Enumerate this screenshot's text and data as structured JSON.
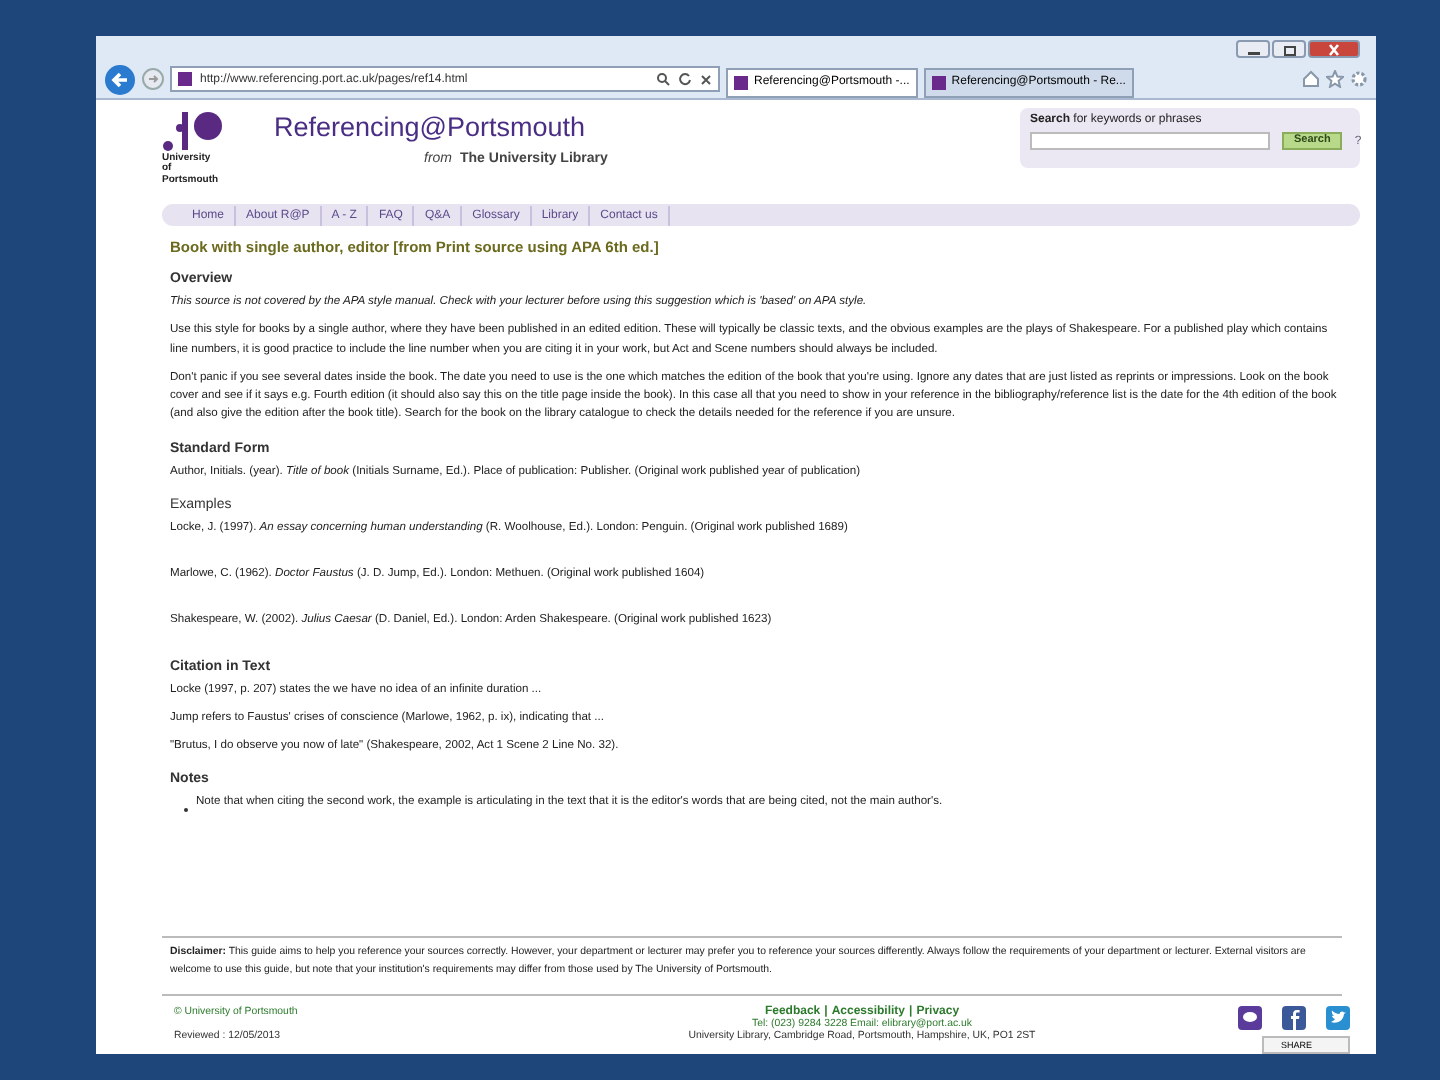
{
  "browser": {
    "url": "http://www.referencing.port.ac.uk/pages/ref14.html",
    "tabs": [
      {
        "label": "Referencing@Portsmouth -...",
        "selected": true
      },
      {
        "label": "Referencing@Portsmouth - Re...",
        "selected": false
      }
    ]
  },
  "header": {
    "logo_text": "University of Portsmouth",
    "title": "Referencing@Portsmouth",
    "from": "from",
    "subtitle": "The University Library",
    "search_label": "**Search** for keywords or phrases",
    "search_button": "Search",
    "search_help": "?"
  },
  "nav": [
    {
      "label": "Home"
    },
    {
      "label": "About R@P"
    },
    {
      "label": "A - Z"
    },
    {
      "label": "FAQ"
    },
    {
      "label": "Q&A"
    },
    {
      "label": "Glossary"
    },
    {
      "label": "Library"
    },
    {
      "label": "Contact us"
    }
  ],
  "page_title": "Book with single author, editor [from Print source using APA 6th ed.]",
  "content": [
    {
      "kind": "heading",
      "text": "Overview"
    },
    {
      "kind": "note",
      "text": "This source is not covered by the APA style manual. Check with your lecturer before using this suggestion which is 'based' on APA style."
    },
    {
      "kind": "para",
      "text": "Use this style for books by a single author, where they have been published in an edited edition. These will typically be classic texts, and the obvious examples are the plays of Shakespeare.  For a published play which contains line numbers, it is good practice to include the line number when you are citing it in your work, but Act and Scene numbers should always be included."
    },
    {
      "kind": "para",
      "text": "Don't panic if you see several dates inside the book. The date you need to use is the one which matches the edition of the book that you're using. Ignore any dates that are just listed as reprints or impressions. Look on the book cover and see if it says e.g. Fourth edition (it should also say this on the title page inside the book). In this case all that you need to show in your reference in the bibliography/reference list is the date for the 4th edition of the book (and also give the edition after the book title). Search for the book on the library catalogue to check the details needed for the reference if you are unsure."
    },
    {
      "kind": "heading",
      "text": "Standard Form"
    },
    {
      "kind": "para",
      "text": "Author, Initials. (year). *Title of book* (Initials Surname, Ed.). Place of publication: Publisher. (Original work published year of publication)"
    },
    {
      "kind": "heading",
      "text": "Examples"
    },
    {
      "kind": "example",
      "text": "Locke, J. (1997). *An essay concerning human understanding* (R. Woolhouse, Ed.). London: Penguin. (Original work published 1689)"
    },
    {
      "kind": "example",
      "text": "Marlowe, C. (1962). *Doctor Faustus* (J. D. Jump, Ed.). London: Methuen. (Original work published 1604)"
    },
    {
      "kind": "example",
      "text": "Shakespeare, W. (2002). *Julius Caesar* (D. Daniel, Ed.). London: Arden Shakespeare. (Original work published 1623)"
    },
    {
      "kind": "heading",
      "text": "Citation in Text"
    },
    {
      "kind": "para",
      "text": "Locke (1997, p. 207) states the we have no idea of an infinite duration ..."
    },
    {
      "kind": "para",
      "text": "Jump refers to Faustus' crises of conscience (Marlowe, 1962, p. ix), indicating that ..."
    },
    {
      "kind": "para",
      "text": "\"Brutus, I do observe you now of late\" (Shakespeare, 2002, Act 1 Scene 2 Line No. 32)."
    },
    {
      "kind": "heading",
      "text": "Notes"
    },
    {
      "kind": "bullet",
      "text": "Note that when citing the second work, the example is articulating in the text that it is the editor's words that are being cited, not the main author's."
    }
  ],
  "disclaimer": "**Disclaimer:** This guide aims to help you reference your sources correctly. However, your department or lecturer may prefer you to reference your sources differently. Always follow the requirements of your department or lecturer. External visitors are welcome to use this guide, but note that your institution's requirements may differ from those used by The University of Portsmouth.",
  "footer": {
    "copyright": "© University of Portsmouth",
    "reviewed": "Reviewed : 12/05/2013",
    "links": [
      "Feedback",
      "Accessibility",
      "Privacy"
    ],
    "separator": "|",
    "contact": "Tel: (023) 9284 3228   Email: elibrary@port.ac.uk",
    "address": "University Library, Cambridge Road, Portsmouth, Hampshire, UK, PO1 2ST",
    "share": "SHARE"
  }
}
